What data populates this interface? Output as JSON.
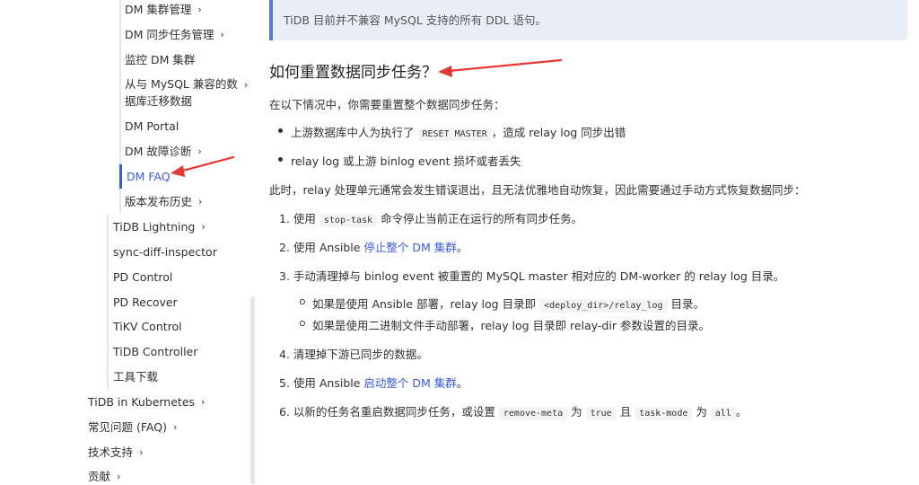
{
  "sidebar": {
    "items": [
      {
        "label": "DM 集群管理",
        "chevron": true
      },
      {
        "label": "DM 同步任务管理",
        "chevron": true
      },
      {
        "label": "监控 DM 集群",
        "chevron": false
      },
      {
        "label": "从与 MySQL 兼容的数据库迁移数据",
        "chevron": true
      },
      {
        "label": "DM Portal",
        "chevron": false
      },
      {
        "label": "DM 故障诊断",
        "chevron": true
      },
      {
        "label": "DM FAQ",
        "chevron": false,
        "active": true
      },
      {
        "label": "版本发布历史",
        "chevron": true
      },
      {
        "label": "TiDB Lightning",
        "chevron": true
      },
      {
        "label": "sync-diff-inspector",
        "chevron": false
      },
      {
        "label": "PD Control",
        "chevron": false
      },
      {
        "label": "PD Recover",
        "chevron": false
      },
      {
        "label": "TiKV Control",
        "chevron": false
      },
      {
        "label": "TiDB Controller",
        "chevron": false
      },
      {
        "label": "工具下载",
        "chevron": false
      },
      {
        "label": "TiDB in Kubernetes",
        "chevron": true
      },
      {
        "label": "常见问题 (FAQ)",
        "chevron": true
      },
      {
        "label": "技术支持",
        "chevron": true
      },
      {
        "label": "贡献",
        "chevron": true
      }
    ],
    "chevron_glyph": "›",
    "multi_line_1": "从与 MySQL 兼容的数",
    "multi_line_2": "据库迁移数据"
  },
  "content": {
    "note": "TiDB 目前并不兼容 MySQL 支持的所有 DDL 语句。",
    "heading": "如何重置数据同步任务？",
    "intro": "在以下情况中，你需要重置整个数据同步任务：",
    "bullets": {
      "b1_pre": "上游数据库中人为执行了",
      "b1_code": "RESET MASTER",
      "b1_post": "，造成 relay log 同步出错",
      "b2": "relay log 或上游 binlog event 损坏或者丢失"
    },
    "para2": "此时，relay 处理单元通常会发生错误退出，且无法优雅地自动恢复，因此需要通过手动方式恢复数据同步：",
    "steps": {
      "s1_pre": "1. 使用",
      "s1_code": "stop-task",
      "s1_post": "命令停止当前正在运行的所有同步任务。",
      "s2_pre": "2. 使用 Ansible",
      "s2_link": "停止整个 DM 集群",
      "s2_post": "。",
      "s3": "3. 手动清理掉与 binlog event 被重置的 MySQL master 相对应的 DM-worker 的 relay log 目录。",
      "s3a_pre": "如果是使用 Ansible 部署，relay log 目录即",
      "s3a_code": "<deploy_dir>/relay_log",
      "s3a_post": "目录。",
      "s3b": "如果是使用二进制文件手动部署，relay log 目录即 relay-dir 参数设置的目录。",
      "s4": "4. 清理掉下游已同步的数据。",
      "s5_pre": "5. 使用 Ansible",
      "s5_link": "启动整个 DM 集群",
      "s5_post": "。",
      "s6_pre": "6. 以新的任务名重启数据同步任务，或设置",
      "s6_code1": "remove-meta",
      "s6_mid1": "为",
      "s6_code2": "true",
      "s6_mid2": "且",
      "s6_code3": "task-mode",
      "s6_mid3": "为",
      "s6_code4": "all",
      "s6_post": "。"
    }
  },
  "colors": {
    "accent": "#3b5bdb",
    "annotation_arrow": "#e53935",
    "note_bg": "#e8edf7"
  }
}
